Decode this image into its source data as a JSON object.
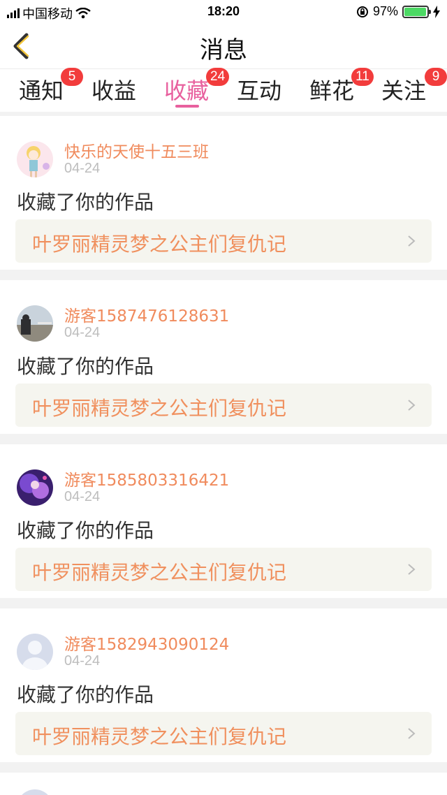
{
  "status_bar": {
    "carrier": "中国移动",
    "time": "18:20",
    "battery": "97%",
    "battery_level": 0.97
  },
  "header": {
    "title": "消息"
  },
  "tabs": [
    {
      "label": "通知",
      "badge": "5",
      "active": false
    },
    {
      "label": "收益",
      "badge": "",
      "active": false
    },
    {
      "label": "收藏",
      "badge": "24",
      "active": true
    },
    {
      "label": "互动",
      "badge": "",
      "active": false
    },
    {
      "label": "鲜花",
      "badge": "11",
      "active": false
    },
    {
      "label": "关注",
      "badge": "9",
      "active": false
    }
  ],
  "colors": {
    "accent": "#e8609e",
    "badge": "#f23c3c",
    "username": "#f08b5d",
    "link_bg": "#f5f5ef"
  },
  "items": [
    {
      "username": "快乐的天使十五三班",
      "date": "04-24",
      "action": "收藏了你的作品",
      "work_title": "叶罗丽精灵梦之公主们复仇记",
      "avatar": "doll-avatar"
    },
    {
      "username": "游客1587476128631",
      "date": "04-24",
      "action": "收藏了你的作品",
      "work_title": "叶罗丽精灵梦之公主们复仇记",
      "avatar": "photo-avatar"
    },
    {
      "username": "游客1585803316421",
      "date": "04-24",
      "action": "收藏了你的作品",
      "work_title": "叶罗丽精灵梦之公主们复仇记",
      "avatar": "anime-avatar"
    },
    {
      "username": "游客1582943090124",
      "date": "04-24",
      "action": "收藏了你的作品",
      "work_title": "叶罗丽精灵梦之公主们复仇记",
      "avatar": "default-avatar"
    }
  ]
}
